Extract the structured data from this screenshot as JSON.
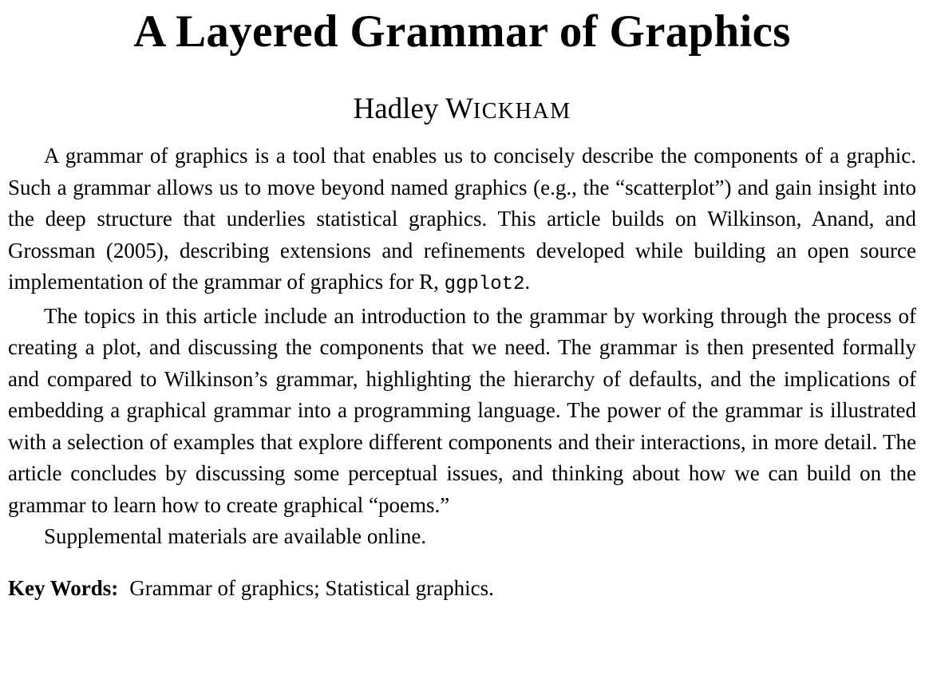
{
  "title": "A Layered Grammar of Graphics",
  "author": {
    "first": "Hadley",
    "last_initial": "W",
    "last_rest": "ICKHAM"
  },
  "abstract": {
    "p1_text": "A grammar of graphics is a tool that enables us to concisely describe the components of a graphic. Such a grammar allows us to move beyond named graphics (e.g., the “scat­terplot”) and gain insight into the deep structure that underlies statistical graphics. This article builds on Wilkinson, Anand, and Grossman (2005), describing extensions and refinements developed while building an open source implementation of the grammar of graphics for R, ",
    "p1_code": "ggplot2",
    "p1_end": ".",
    "p2": "The topics in this article include an introduction to the grammar by working through the process of creating a plot, and discussing the components that we need. The gram­mar is then presented formally and compared to Wilkinson’s grammar, highlighting the hierarchy of defaults, and the implications of embedding a graphical grammar into a programming language. The power of the grammar is illustrated with a selection of examples that explore different components and their interactions, in more detail. The article concludes by discussing some perceptual issues, and thinking about how we can build on the grammar to learn how to create graphical “poems.”",
    "p3": "Supplemental materials are available online."
  },
  "keywords": {
    "label": "Key Words:",
    "text": "Grammar of graphics; Statistical graphics."
  }
}
